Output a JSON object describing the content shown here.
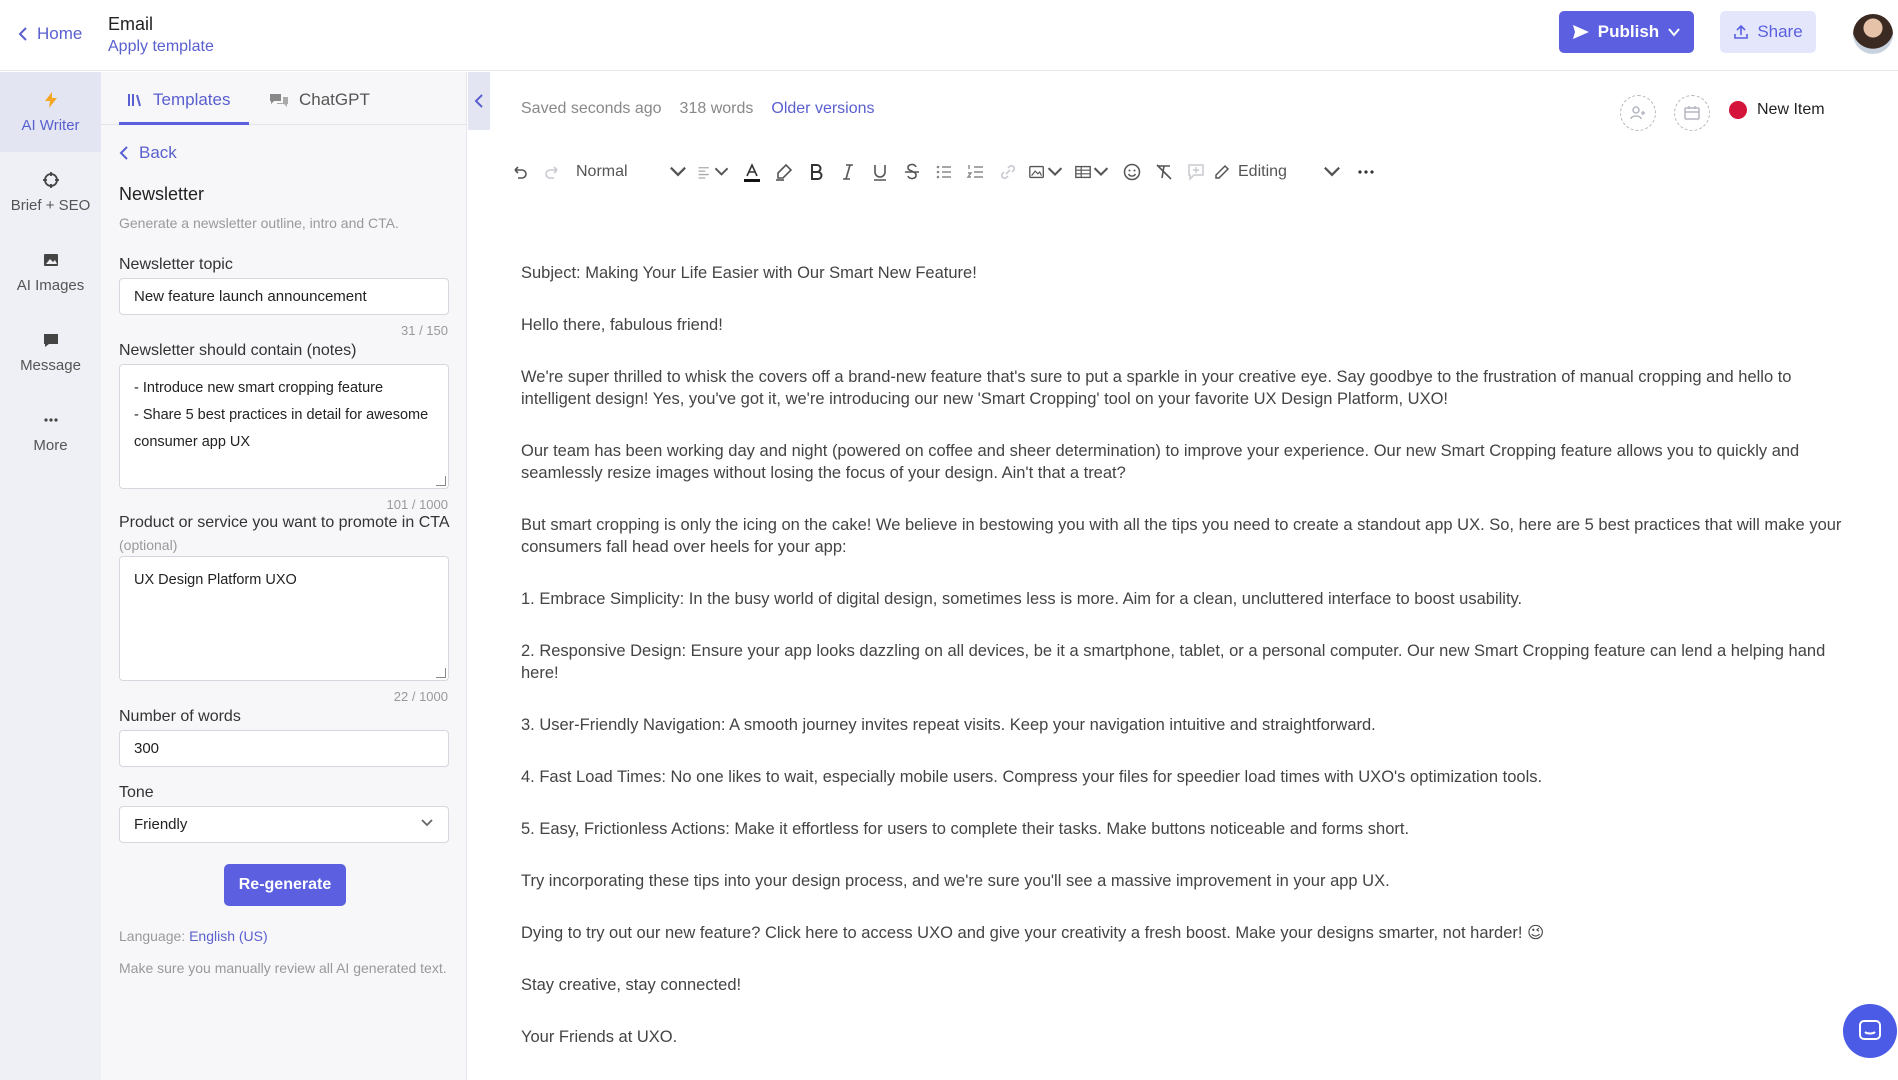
{
  "header": {
    "home_label": "Home",
    "doc_title": "Email",
    "apply_template": "Apply template",
    "publish_label": "Publish",
    "share_label": "Share"
  },
  "rail": {
    "items": [
      {
        "label": "AI Writer",
        "icon": "lightning-icon"
      },
      {
        "label": "Brief + SEO",
        "icon": "crosshair-icon"
      },
      {
        "label": "AI Images",
        "icon": "image-icon"
      },
      {
        "label": "Message",
        "icon": "message-icon"
      },
      {
        "label": "More",
        "icon": "more-icon"
      }
    ]
  },
  "panel": {
    "tabs": [
      {
        "label": "Templates",
        "icon": "library-icon"
      },
      {
        "label": "ChatGPT",
        "icon": "chat-icon"
      }
    ],
    "back_label": "Back",
    "title": "Newsletter",
    "description": "Generate a newsletter outline, intro and CTA.",
    "topic": {
      "label": "Newsletter topic",
      "value": "New feature launch announcement",
      "counter": "31 / 150"
    },
    "notes": {
      "label": "Newsletter should contain (notes)",
      "value": "- Introduce new smart cropping feature\n- Share 5 best practices in detail for awesome consumer app UX",
      "counter": "101 / 1000"
    },
    "cta": {
      "label": "Product or service you want to promote in CTA",
      "optional": "(optional)",
      "value": "UX Design Platform UXO",
      "counter": "22 / 1000"
    },
    "words": {
      "label": "Number of words",
      "value": "300"
    },
    "tone": {
      "label": "Tone",
      "value": "Friendly"
    },
    "regenerate_label": "Re-generate",
    "language_prefix": "Language:",
    "language_value": "English (US)",
    "review_note": "Make sure you manually review all AI generated text."
  },
  "status": {
    "saved": "Saved seconds ago",
    "words": "318 words",
    "older_versions": "Older versions",
    "new_item": "New Item"
  },
  "toolbar": {
    "style": "Normal",
    "mode": "Editing"
  },
  "document": {
    "paragraphs": [
      "Subject: Making Your Life Easier with Our Smart New Feature!",
      "Hello there, fabulous friend!",
      "We're super thrilled to whisk the covers off a brand-new feature that's sure to put a sparkle in your creative eye. Say goodbye to the frustration of manual cropping and hello to intelligent design! Yes, you've got it, we're introducing our new 'Smart Cropping' tool on your favorite UX Design Platform, UXO!",
      "Our team has been working day and night (powered on coffee and sheer determination) to improve your experience. Our new Smart Cropping feature allows you to quickly and seamlessly resize images without losing the focus of your design. Ain't that a treat?",
      "But smart cropping is only the icing on the cake! We believe in bestowing you with all the tips you need to create a standout app UX. So, here are 5 best practices that will make your consumers fall head over heels for your app:",
      "1. Embrace Simplicity: In the busy world of digital design, sometimes less is more. Aim for a clean, uncluttered interface to boost usability.",
      "2. Responsive Design: Ensure your app looks dazzling on all devices, be it a smartphone, tablet, or a personal computer. Our new Smart Cropping feature can lend a helping hand here!",
      "3. User-Friendly Navigation: A smooth journey invites repeat visits. Keep your navigation intuitive and straightforward.",
      "4. Fast Load Times: No one likes to wait, especially mobile users. Compress your files for speedier load times with UXO's optimization tools.",
      "5. Easy, Frictionless Actions: Make it effortless for users to complete their tasks. Make buttons noticeable and forms short.",
      "Try incorporating these tips into your design process, and we're sure you'll see a massive improvement in your app UX.",
      "Dying to try out our new feature? Click here to access UXO and give your creativity a fresh boost. Make your designs smarter, not harder! 😉",
      "Stay creative, stay connected!",
      "Your Friends at UXO."
    ]
  },
  "colors": {
    "accent": "#5b5fe0",
    "new_item_dot": "#d5143c"
  }
}
